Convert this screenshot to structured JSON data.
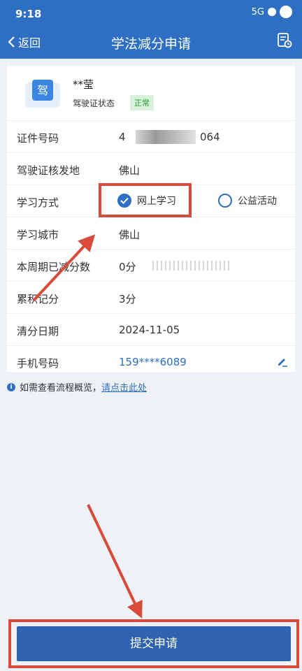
{
  "status": {
    "time": "9:18",
    "network_label": "5G"
  },
  "nav": {
    "back_label": "返回",
    "title": "学法减分申请"
  },
  "profile": {
    "name": "**莹",
    "license_icon_text": "驾",
    "status_label": "驾驶证状态",
    "status_badge": "正常"
  },
  "rows": [
    {
      "label": "证件号码",
      "value_prefix": "4",
      "value_suffix": "064"
    },
    {
      "label": "驾驶证核发地",
      "value": "佛山"
    },
    {
      "label": "学习方式",
      "options": [
        "网上学习",
        "公益活动"
      ],
      "selected": "网上学习"
    },
    {
      "label": "学习城市",
      "value": "佛山"
    },
    {
      "label": "本周期已减分数",
      "value": "0分"
    },
    {
      "label": "累积记分",
      "value": "3分"
    },
    {
      "label": "清分日期",
      "value": "2024-11-05"
    },
    {
      "label": "手机号码",
      "value": "159****6089"
    }
  ],
  "info": {
    "text": "如需查看流程概览，",
    "link": "请点击此处"
  },
  "submit": {
    "label": "提交申请"
  },
  "colors": {
    "primary": "#2e6fc4",
    "annotation": "#d84a3a",
    "badge_bg": "#d8f2da",
    "badge_text": "#2c9a3a"
  }
}
